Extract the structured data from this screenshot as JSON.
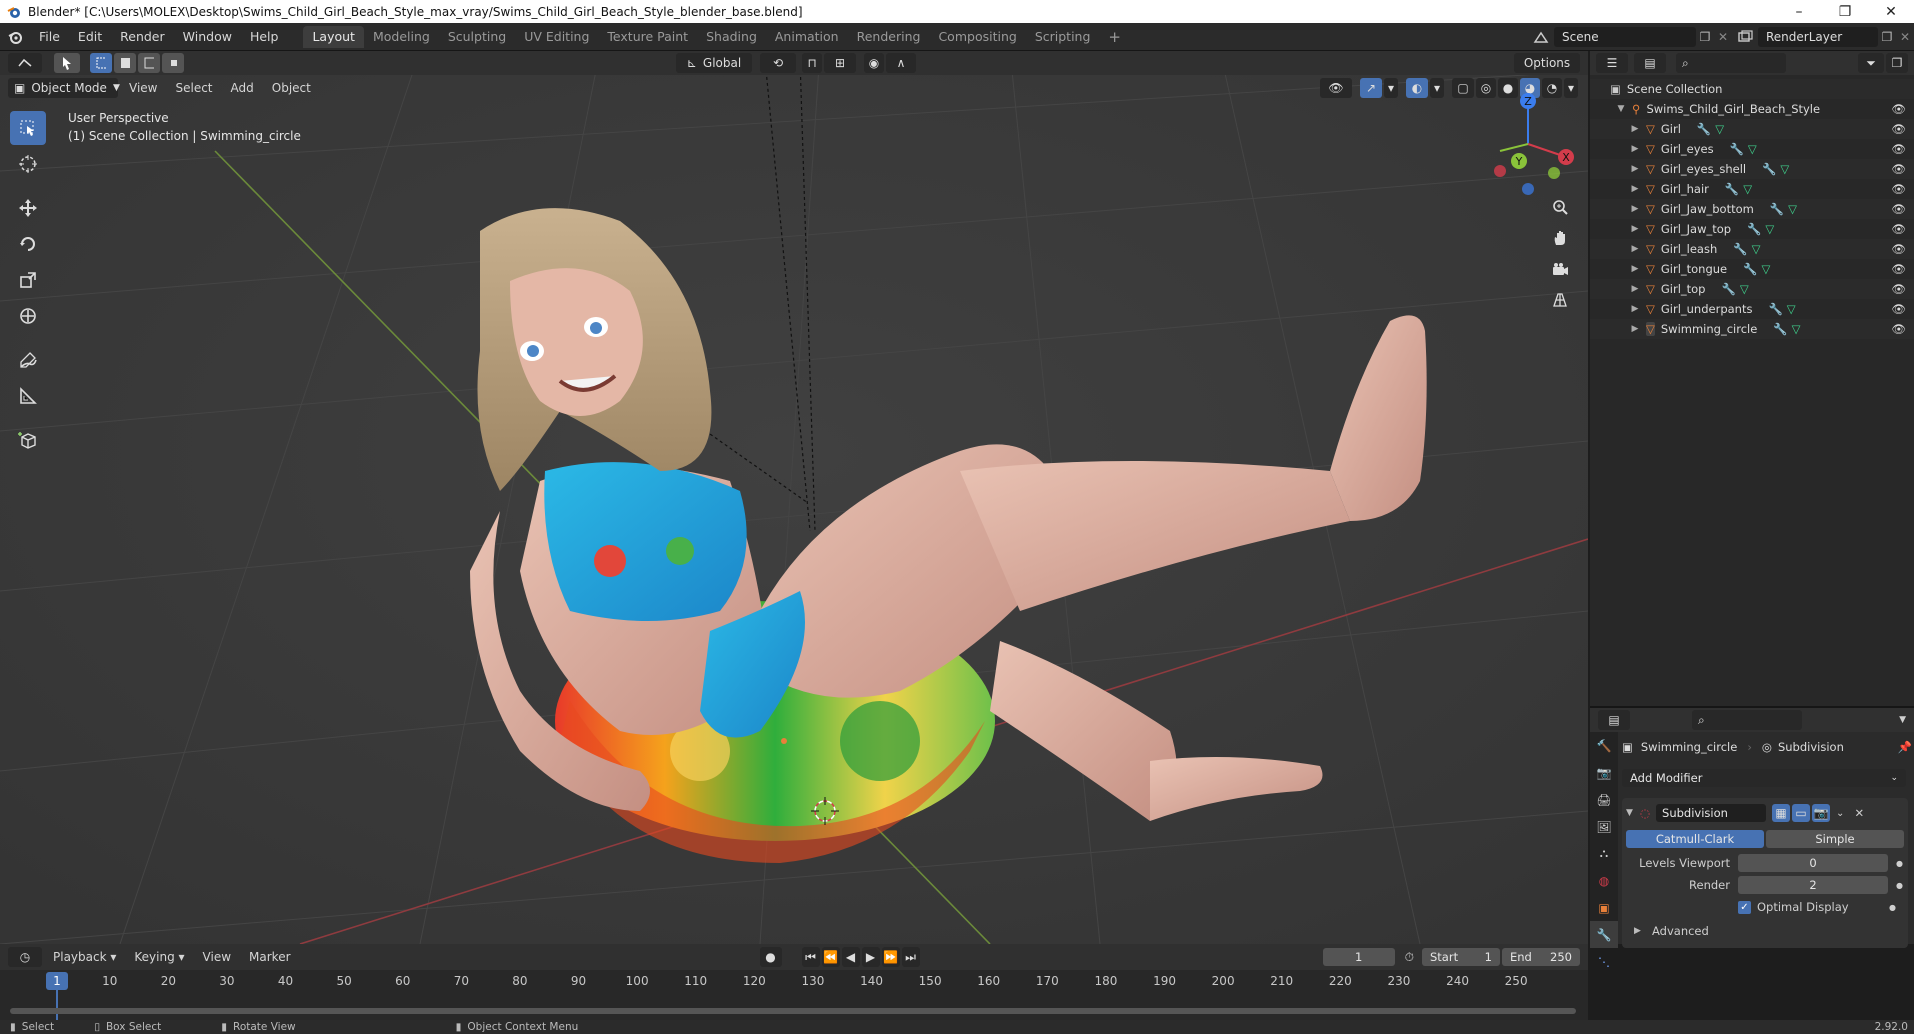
{
  "window": {
    "title": "Blender* [C:\\Users\\MOLEX\\Desktop\\Swims_Child_Girl_Beach_Style_max_vray/Swims_Child_Girl_Beach_Style_blender_base.blend]",
    "minimize": "–",
    "maximize": "❐",
    "close": "✕"
  },
  "menu": [
    "File",
    "Edit",
    "Render",
    "Window",
    "Help"
  ],
  "workspaces": [
    "Layout",
    "Modeling",
    "Sculpting",
    "UV Editing",
    "Texture Paint",
    "Shading",
    "Animation",
    "Rendering",
    "Compositing",
    "Scripting"
  ],
  "active_workspace": "Layout",
  "scene_field": "Scene",
  "renderlayer_field": "RenderLayer",
  "viewport_header": {
    "transform_orientation": "Global",
    "options_label": "Options",
    "mode": "Object Mode",
    "menus": [
      "View",
      "Select",
      "Add",
      "Object"
    ]
  },
  "viewport_overlay": {
    "perspective": "User Perspective",
    "collection_info": "(1) Scene Collection | Swimming_circle"
  },
  "gizmo_axes": {
    "z": "Z",
    "y": "Y",
    "x": "X"
  },
  "outliner": {
    "root": "Scene Collection",
    "collection": "Swims_Child_Girl_Beach_Style",
    "items": [
      "Girl",
      "Girl_eyes",
      "Girl_eyes_shell",
      "Girl_hair",
      "Girl_Jaw_bottom",
      "Girl_Jaw_top",
      "Girl_leash",
      "Girl_tongue",
      "Girl_top",
      "Girl_underpants",
      "Swimming_circle"
    ]
  },
  "properties": {
    "object_name": "Swimming_circle",
    "modifier_breadcrumb": "Subdivision",
    "add_modifier": "Add Modifier",
    "modifier_name": "Subdivision",
    "mode_catmull": "Catmull-Clark",
    "mode_simple": "Simple",
    "levels_viewport_label": "Levels Viewport",
    "levels_viewport_value": "0",
    "render_label": "Render",
    "render_value": "2",
    "optimal_display": "Optimal Display",
    "advanced": "Advanced"
  },
  "timeline": {
    "menus": [
      "Playback",
      "Keying",
      "View",
      "Marker"
    ],
    "current_frame": "1",
    "start_label": "Start",
    "start_value": "1",
    "end_label": "End",
    "end_value": "250",
    "ticks": [
      "1",
      "10",
      "20",
      "30",
      "40",
      "50",
      "60",
      "70",
      "80",
      "90",
      "100",
      "110",
      "120",
      "130",
      "140",
      "150",
      "160",
      "170",
      "180",
      "190",
      "200",
      "210",
      "220",
      "230",
      "240",
      "250"
    ]
  },
  "statusbar": {
    "select": "Select",
    "box_select": "Box Select",
    "rotate_view": "Rotate View",
    "context_menu": "Object Context Menu",
    "version": "2.92.0"
  },
  "colors": {
    "accent": "#4772b3",
    "object_orange": "#e8803a",
    "mesh_green": "#3fd08c",
    "axis_red": "#d33c4b",
    "axis_green": "#8ac33a",
    "axis_blue": "#3b7ded"
  }
}
